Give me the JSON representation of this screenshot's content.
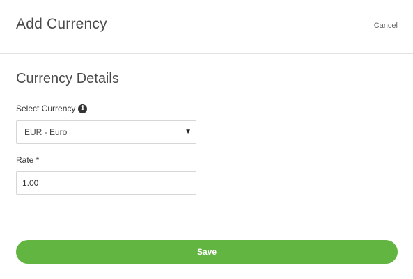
{
  "header": {
    "title": "Add Currency",
    "cancel_label": "Cancel"
  },
  "section": {
    "title": "Currency Details"
  },
  "currency_field": {
    "label": "Select Currency",
    "info_icon": "info-icon",
    "selected_value": "EUR - Euro"
  },
  "rate_field": {
    "label": "Rate *",
    "value": "1.00"
  },
  "actions": {
    "save_label": "Save"
  },
  "colors": {
    "save_button": "#63b542"
  }
}
